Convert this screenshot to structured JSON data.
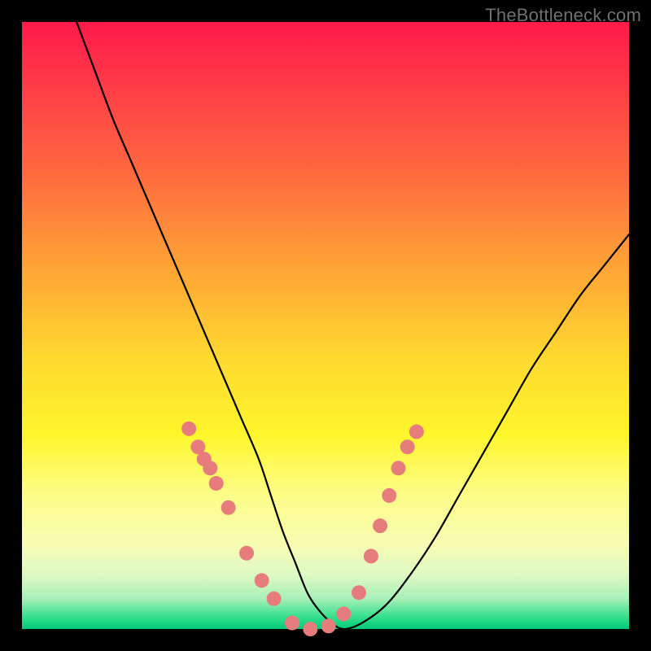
{
  "watermark_text": "TheBottleneck.com",
  "colors": {
    "dot": "#e77c7c",
    "curve": "#000000",
    "frame_bg_top": "#ff1a4a",
    "frame_bg_bottom": "#00c97a",
    "page_bg": "#000000"
  },
  "chart_data": {
    "type": "line",
    "title": "",
    "xlabel": "",
    "ylabel": "",
    "xlim": [
      0,
      100
    ],
    "ylim": [
      0,
      100
    ],
    "grid": false,
    "legend": false,
    "series": [
      {
        "name": "bottleneck-curve",
        "kind": "smooth-line",
        "x": [
          9,
          12,
          15,
          18,
          21,
          24,
          27,
          30,
          33,
          36,
          39,
          41,
          43,
          45,
          47,
          49,
          51,
          53,
          56,
          60,
          64,
          68,
          72,
          76,
          80,
          84,
          88,
          92,
          96,
          100
        ],
        "y": [
          100,
          92,
          84,
          77,
          70,
          63,
          56,
          49,
          42,
          35,
          28,
          22,
          16,
          11,
          6,
          3,
          1,
          0,
          1,
          4,
          9,
          15,
          22,
          29,
          36,
          43,
          49,
          55,
          60,
          65
        ]
      },
      {
        "name": "marker-dots",
        "kind": "scatter",
        "x": [
          27.5,
          29.0,
          30.0,
          31.0,
          32.0,
          34.0,
          37.0,
          39.5,
          41.5,
          44.5,
          47.5,
          50.5,
          53.0,
          55.5,
          57.5,
          59.0,
          60.5,
          62.0,
          63.5,
          65.0
        ],
        "y": [
          33.0,
          30.0,
          28.0,
          26.5,
          24.0,
          20.0,
          12.5,
          8.0,
          5.0,
          1.0,
          0.0,
          0.5,
          2.5,
          6.0,
          12.0,
          17.0,
          22.0,
          26.5,
          30.0,
          32.5
        ]
      }
    ]
  }
}
